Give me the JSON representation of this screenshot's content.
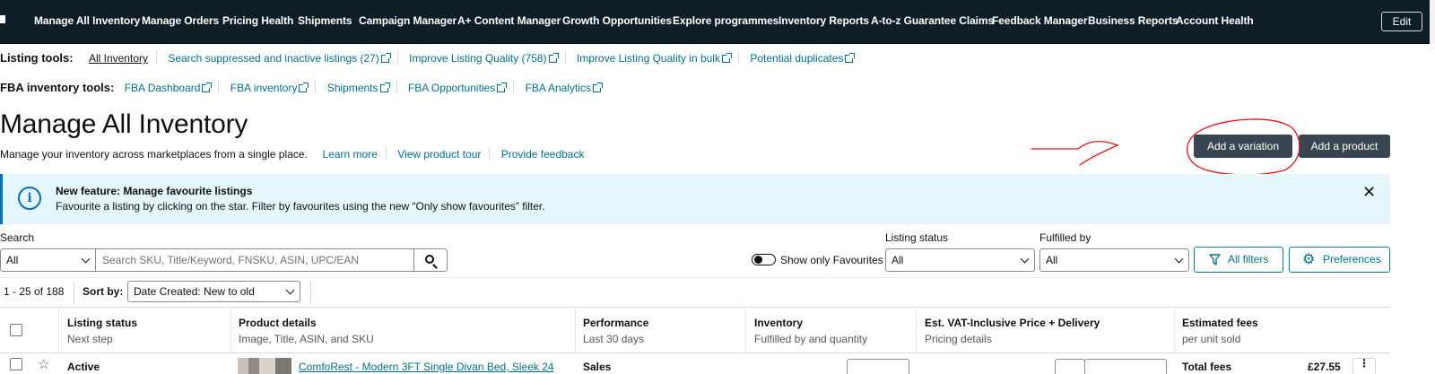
{
  "topnav": {
    "items": [
      "Manage All Inventory",
      "Manage Orders",
      "Pricing Health",
      "Shipments",
      "Campaign Manager",
      "A+ Content Manager",
      "Growth Opportunities",
      "Explore programmes",
      "Inventory Reports",
      "A-to-z Guarantee Claims",
      "Feedback Manager",
      "Business Reports",
      "Account Health"
    ],
    "edit_label": "Edit"
  },
  "listing_tools": {
    "label": "Listing tools:",
    "links": [
      "All Inventory",
      "Search suppressed and inactive listings (27)",
      "Improve Listing Quality (758)",
      "Improve Listing Quality in bulk",
      "Potential duplicates"
    ]
  },
  "fba_tools": {
    "label": "FBA inventory tools:",
    "links": [
      "FBA Dashboard",
      "FBA inventory",
      "Shipments",
      "FBA Opportunities",
      "FBA Analytics"
    ]
  },
  "header": {
    "title": "Manage All Inventory",
    "description": "Manage your inventory across marketplaces from a single place.",
    "links": [
      "Learn more",
      "View product tour",
      "Provide feedback"
    ],
    "add_variation_label": "Add a variation",
    "add_product_label": "Add a product"
  },
  "banner": {
    "title": "New feature: Manage favourite listings",
    "text": "Favourite a listing by clicking on the star. Filter by favourites using the new “Only show favourites” filter."
  },
  "filters": {
    "search_label": "Search",
    "search_scope": "All",
    "search_placeholder": "Search SKU, Title/Keyword, FNSKU, ASIN, UPC/EAN",
    "favourites_toggle_label": "Show only Favourites",
    "listing_status_label": "Listing status",
    "listing_status_value": "All",
    "fulfilled_by_label": "Fulfilled by",
    "fulfilled_by_value": "All",
    "all_filters_label": "All filters",
    "preferences_label": "Preferences"
  },
  "results": {
    "count": "1 - 25 of 188",
    "sort_label": "Sort by:",
    "sort_value": "Date Created: New to old"
  },
  "table": {
    "columns": [
      {
        "title": "Listing status",
        "sub": "Next step"
      },
      {
        "title": "Product details",
        "sub": "Image, Title, ASIN, and SKU"
      },
      {
        "title": "Performance",
        "sub": "Last 30 days"
      },
      {
        "title": "Inventory",
        "sub": "Fulfilled by and quantity"
      },
      {
        "title": "Est. VAT-Inclusive Price + Delivery",
        "sub": "Pricing details"
      },
      {
        "title": "Estimated fees",
        "sub": "per unit sold"
      }
    ],
    "first_row": {
      "status": "Active",
      "title": "ComfoRest - Modern 3FT Single Divan Bed, Sleek 24",
      "performance_label": "Sales",
      "fees_label": "Total fees",
      "fees_value": "£27.55"
    }
  },
  "colors": {
    "nav_bg": "#0f1d26",
    "link": "#007185",
    "dark_button": "#394551",
    "banner_bg": "#e6f6fd",
    "annotation": "#e1161b"
  }
}
